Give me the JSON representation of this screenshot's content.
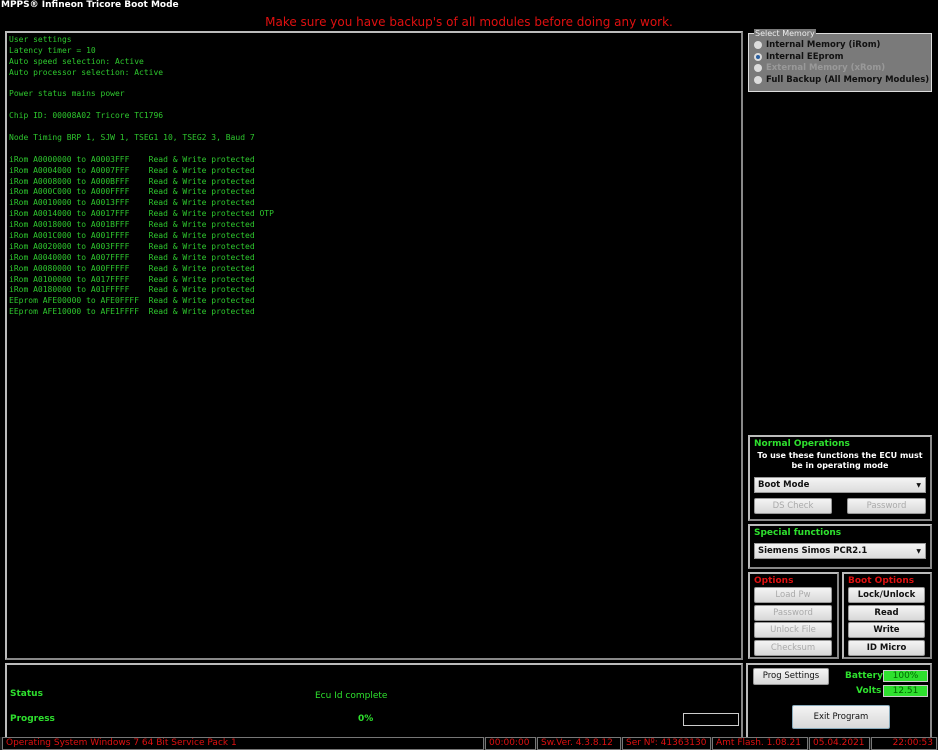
{
  "window": {
    "title": "MPPS® Infineon Tricore Boot Mode"
  },
  "warning": "Make sure you have backup's of all modules before doing any work.",
  "console": [
    "User settings",
    "Latency timer = 10",
    "Auto speed selection: Active",
    "Auto processor selection: Active",
    "",
    "Power status mains power",
    "",
    "Chip ID: 00008A02 Tricore TC1796",
    "",
    "Node Timing BRP 1, SJW 1, TSEG1 10, TSEG2 3, Baud 7",
    "",
    "iRom A0000000 to A0003FFF    Read & Write protected",
    "iRom A0004000 to A0007FFF    Read & Write protected",
    "iRom A0008000 to A000BFFF    Read & Write protected",
    "iRom A000C000 to A000FFFF    Read & Write protected",
    "iRom A0010000 to A0013FFF    Read & Write protected",
    "iRom A0014000 to A0017FFF    Read & Write protected OTP",
    "iRom A0018000 to A001BFFF    Read & Write protected",
    "iRom A001C000 to A001FFFF    Read & Write protected",
    "iRom A0020000 to A003FFFF    Read & Write protected",
    "iRom A0040000 to A007FFFF    Read & Write protected",
    "iRom A0080000 to A00FFFFF    Read & Write protected",
    "iRom A0100000 to A017FFFF    Read & Write protected",
    "iRom A0180000 to A01FFFFF    Read & Write protected",
    "EEprom AFE00000 to AFE0FFFF  Read & Write protected",
    "EEprom AFE10000 to AFE1FFFF  Read & Write protected"
  ],
  "select_memory": {
    "legend": "Select Memory",
    "options": [
      {
        "label": "Internal Memory (iRom)",
        "selected": false,
        "enabled": true
      },
      {
        "label": "Internal EEprom",
        "selected": true,
        "enabled": true
      },
      {
        "label": "External Memory (xRom)",
        "selected": false,
        "enabled": false
      },
      {
        "label": "Full Backup (All Memory Modules)",
        "selected": false,
        "enabled": true
      }
    ]
  },
  "normal_ops": {
    "title": "Normal Operations",
    "note": "To use these functions the ECU must be in operating mode",
    "mode": "Boot Mode",
    "ds_check": "DS Check",
    "password": "Password"
  },
  "special": {
    "title": "Special functions",
    "selected": "Siemens Simos PCR2.1"
  },
  "options": {
    "title": "Options",
    "buttons": [
      "Load Pw",
      "Password",
      "Unlock File",
      "Checksum"
    ]
  },
  "boot_options": {
    "title": "Boot Options",
    "buttons": [
      "Lock/Unlock",
      "Read",
      "Write",
      "ID Micro"
    ]
  },
  "status": {
    "status_label": "Status",
    "status_value": "Ecu Id complete",
    "progress_label": "Progress",
    "progress_value": "0%",
    "progress": 0
  },
  "controls": {
    "prog_settings": "Prog Settings",
    "battery_label": "Battery",
    "battery_value": "100%",
    "volts_label": "Volts",
    "volts_value": "12.51",
    "exit": "Exit Program"
  },
  "statusbar": {
    "os": "Operating System Windows 7 64 Bit Service Pack 1",
    "elapsed": "00:00:00",
    "sw_ver": "Sw.Ver. 4.3.8.12",
    "serial": "Ser Nº: 41363130",
    "flash": "Amt Flash. 1.08.21",
    "date": "05.04.2021",
    "time": "22:00:53"
  },
  "colors": {
    "console_text": "#2ec82e",
    "warning": "#e01010",
    "accent_green": "#2ee02e"
  }
}
